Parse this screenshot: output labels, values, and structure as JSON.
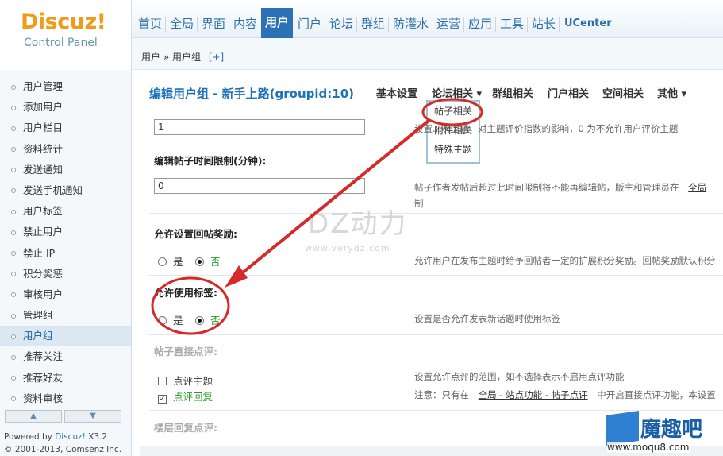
{
  "logo": {
    "brand": "Discuz!",
    "subtitle": "Control Panel"
  },
  "topnav": [
    "首页",
    "全局",
    "界面",
    "内容",
    "用户",
    "门户",
    "论坛",
    "群组",
    "防灌水",
    "运营",
    "应用",
    "工具",
    "站长",
    "UCenter"
  ],
  "breadcrumb": {
    "path": "用户 » 用户组",
    "plus": "[+]"
  },
  "sidebar": {
    "items": [
      "用户管理",
      "添加用户",
      "用户栏目",
      "资料统计",
      "发送通知",
      "发送手机通知",
      "用户标签",
      "禁止用户",
      "禁止 IP",
      "积分奖惩",
      "审核用户",
      "管理组",
      "用户组",
      "推荐关注",
      "推荐好友",
      "资料审核"
    ],
    "active": "用户组",
    "up": "▲",
    "down": "▼",
    "powered_prefix": "Powered by ",
    "powered_brand": "Discuz!",
    "powered_version": " X3.2",
    "copyright": "© 2001-2013, Comsenz Inc."
  },
  "main": {
    "title": "编辑用户组 - 新手上路(groupid:10)",
    "tabs": [
      "基本设置",
      "论坛相关 ▾",
      "群组相关",
      "门户相关",
      "空间相关",
      "其他 ▾"
    ],
    "dropdown": [
      "帖子相关",
      "附件相关",
      "特殊主题"
    ],
    "row1": {
      "value": "1",
      "hint": "设置...次主题，对主题评价指数的影响，0 为不允许用户评价主题"
    },
    "row2": {
      "label": "编辑帖子时间限制(分钟):",
      "value": "0",
      "hint1_prefix": "帖子作者发帖后超过此时间限制将不能再编辑帖，版主和管理员在",
      "hint1_link": "全局",
      "hint2": "制"
    },
    "row3": {
      "label": "允许设置回帖奖励:",
      "yes": "是",
      "no": "否",
      "hint": "允许用户在发布主题时给予回帖者一定的扩展积分奖励。回帖奖励默认积分"
    },
    "row4": {
      "label": "允许使用标签:",
      "yes": "是",
      "no": "否",
      "hint": "设置是否允许发表新话题时使用标签"
    },
    "row5": {
      "label": "帖子直接点评:",
      "opt1": "点评主题",
      "opt2": "点评回复",
      "check_mark": "✓",
      "hint1": "设置允许点评的范围，如不选择表示不启用点评功能",
      "hint2_prefix": "注意：只有在",
      "hint2_link": "全局 - 站点功能 - 帖子点评",
      "hint2_suffix": "中开启直接点评功能，本设置"
    },
    "row6": {
      "label": "楼层回复点评:"
    }
  },
  "watermark": {
    "big": "DZ动力",
    "small": "www.verydz.com"
  },
  "corner_logo": {
    "name": "魔趣吧",
    "url": "www.moqu8.com"
  },
  "colors": {
    "nav_active": "#2b71b5",
    "annotation_red": "#d42a2a",
    "link_blue": "#1e72b7"
  }
}
